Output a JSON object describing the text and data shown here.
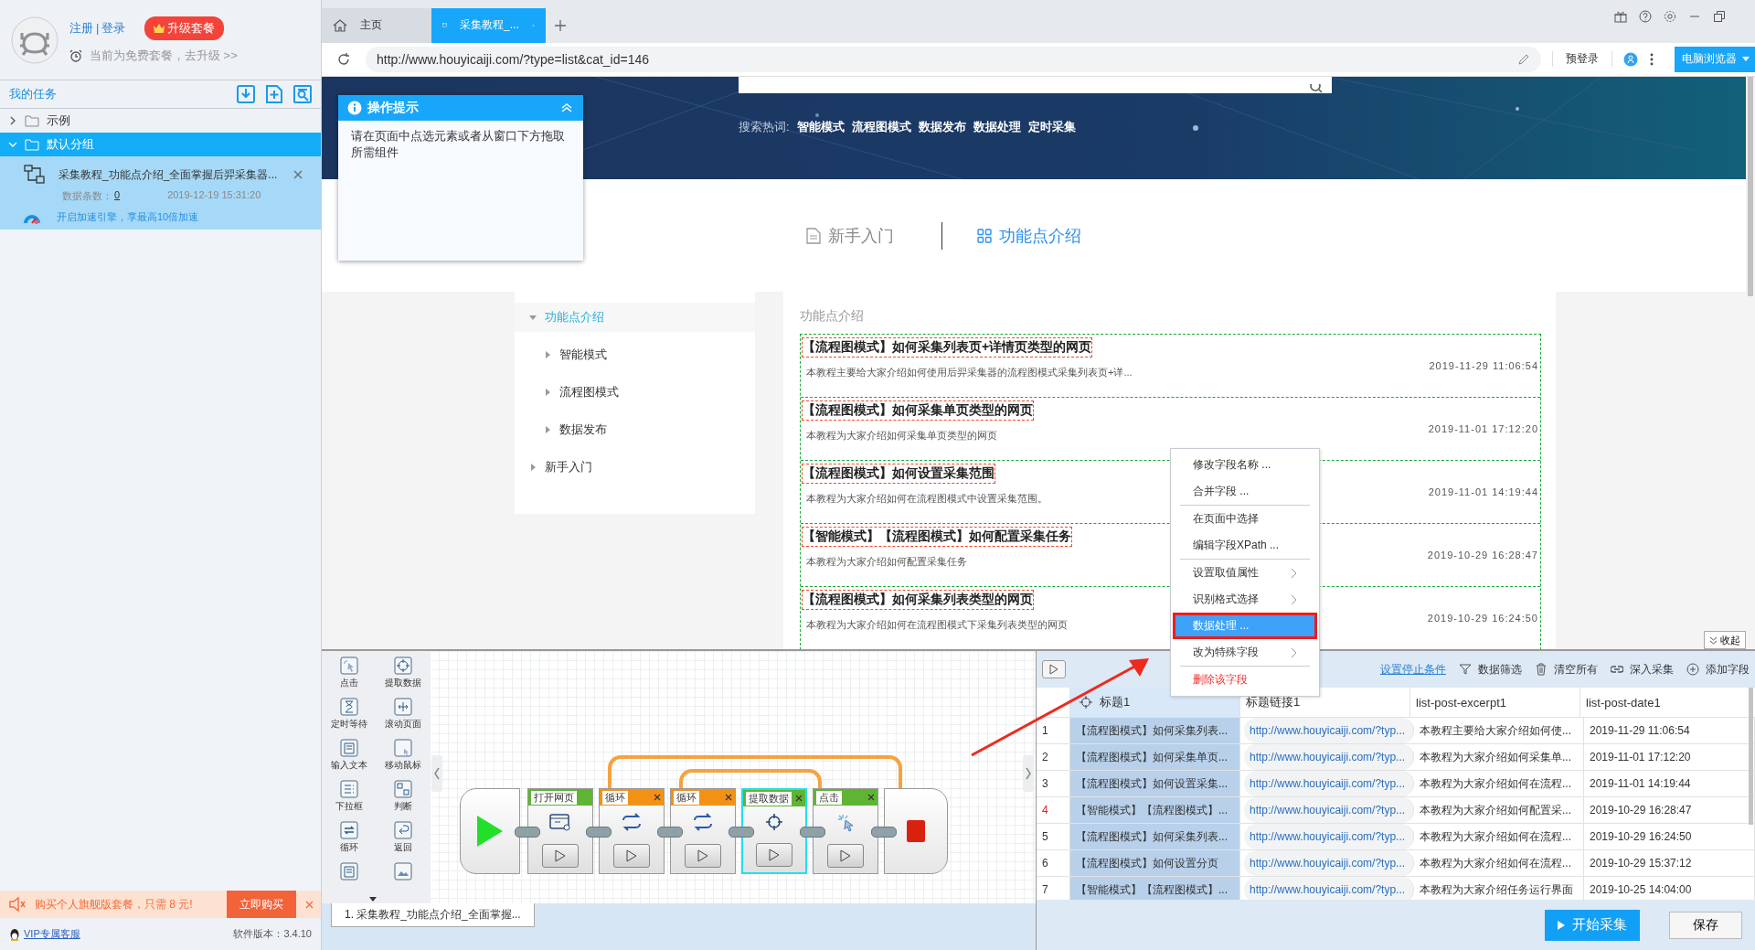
{
  "sidebar": {
    "register_link": "注册",
    "link_separator": "|",
    "login_link": "登录",
    "upgrade_button": "升级套餐",
    "plan_notice": "当前为免费套餐，去升级 >>",
    "tasks_title": "我的任务",
    "groups": [
      {
        "label": "示例",
        "expanded": false,
        "selected": false
      },
      {
        "label": "默认分组",
        "expanded": true,
        "selected": true,
        "children": [
          {
            "title": "采集教程_功能点介绍_全面掌握后羿采集器...",
            "count_label": "数据条数：",
            "count": "0",
            "date": "2019-12-19 15:31:20",
            "accelerate": "开启加速引擎，享最高10倍加速"
          }
        ]
      }
    ],
    "promo": {
      "text": "购买个人旗舰版套餐，只需 8 元!",
      "button": "立即购买"
    },
    "support_link": "VIP专属客服",
    "version": "软件版本：3.4.10"
  },
  "browser": {
    "tabs": [
      {
        "label": "主页",
        "kind": "home",
        "selected": false
      },
      {
        "label": "采集教程_...",
        "kind": "page",
        "selected": true
      }
    ],
    "url": "http://www.houyicaiji.com/?type=list&cat_id=146",
    "pre_login": "预登录",
    "mode_button": "电脑浏览器"
  },
  "page": {
    "hot_label": "搜索热词:",
    "hot_words": [
      "智能模式",
      "流程图模式",
      "数据发布",
      "数据处理",
      "定时采集"
    ],
    "section_tabs": [
      {
        "label": "新手入门",
        "kind": "doc",
        "selected": false
      },
      {
        "label": "功能点介绍",
        "kind": "grid",
        "selected": true
      }
    ],
    "nav": [
      {
        "label": "功能点介绍",
        "expanded": true,
        "selected": true,
        "children": [
          {
            "label": "智能模式"
          },
          {
            "label": "流程图模式"
          },
          {
            "label": "数据发布"
          }
        ]
      },
      {
        "label": "新手入门",
        "expanded": false,
        "selected": false
      }
    ],
    "list_title": "功能点介绍",
    "articles": [
      {
        "title": "【流程图模式】如何采集列表页+详情页类型的网页",
        "excerpt": "本教程主要给大家介绍如何使用后羿采集器的流程图模式采集列表页+详...",
        "date": "2019-11-29 11:06:54"
      },
      {
        "title": "【流程图模式】如何采集单页类型的网页",
        "excerpt": "本教程为大家介绍如何采集单页类型的网页",
        "date": "2019-11-01 17:12:20"
      },
      {
        "title": "【流程图模式】如何设置采集范围",
        "excerpt": "本教程为大家介绍如何在流程图模式中设置采集范围。",
        "date": "2019-11-01 14:19:44"
      },
      {
        "title": "【智能模式】【流程图模式】如何配置采集任务",
        "excerpt": "本教程为大家介绍如何配置采集任务",
        "date": "2019-10-29 16:28:47"
      },
      {
        "title": "【流程图模式】如何采集列表类型的网页",
        "excerpt": "本教程为大家介绍如何在流程图模式下采集列表类型的网页",
        "date": "2019-10-29 16:24:50"
      }
    ]
  },
  "tip_popup": {
    "title": "操作提示",
    "text": "请在页面中点选元素或者从窗口下方拖取所需组件"
  },
  "context_menu": [
    {
      "kind": "item",
      "label": "修改字段名称 ...",
      "submenu": false,
      "selected": false
    },
    {
      "kind": "item",
      "label": "合并字段 ...",
      "submenu": false,
      "selected": false
    },
    {
      "kind": "separator"
    },
    {
      "kind": "item",
      "label": "在页面中选择",
      "submenu": false,
      "selected": false
    },
    {
      "kind": "item",
      "label": "编辑字段XPath ...",
      "submenu": false,
      "selected": false
    },
    {
      "kind": "separator"
    },
    {
      "kind": "item",
      "label": "设置取值属性",
      "submenu": true,
      "selected": false
    },
    {
      "kind": "item",
      "label": "识别格式选择",
      "submenu": true,
      "selected": false
    },
    {
      "kind": "item",
      "label": "数据处理 ...",
      "submenu": false,
      "selected": true
    },
    {
      "kind": "item",
      "label": "改为特殊字段",
      "submenu": true,
      "selected": false
    },
    {
      "kind": "separator"
    },
    {
      "kind": "danger",
      "label": "删除该字段",
      "submenu": false,
      "selected": false
    }
  ],
  "collapse_button": "收起",
  "workflow": {
    "toolbox": [
      {
        "label": "点击",
        "kind": "click"
      },
      {
        "label": "提取数据",
        "kind": "extract"
      },
      {
        "label": "定时等待",
        "kind": "wait"
      },
      {
        "label": "滚动页面",
        "kind": "scroll"
      },
      {
        "label": "输入文本",
        "kind": "input"
      },
      {
        "label": "移动鼠标",
        "kind": "mouse"
      },
      {
        "label": "下拉框",
        "kind": "dropdown"
      },
      {
        "label": "判断",
        "kind": "branch"
      },
      {
        "label": "循环",
        "kind": "loop"
      },
      {
        "label": "返回",
        "kind": "back"
      },
      {
        "kind": "input"
      },
      {
        "kind": "image"
      }
    ],
    "nodes": [
      {
        "label": "打开网页",
        "kind": "open",
        "selected": false
      },
      {
        "label": "循环",
        "kind": "loop",
        "selected": false,
        "children": [
          {
            "label": "循环",
            "kind": "loop",
            "selected": false,
            "children": [
              {
                "label": "提取数据",
                "kind": "extract",
                "selected": true
              }
            ]
          },
          {
            "label": "点击",
            "kind": "click",
            "selected": false
          }
        ]
      }
    ],
    "task_tab": "1. 采集教程_功能点介绍_全面掌握..."
  },
  "data_table": {
    "stop_condition": "设置停止条件",
    "actions": [
      {
        "label": "数据筛选",
        "kind": "filter"
      },
      {
        "label": "清空所有",
        "kind": "clear"
      },
      {
        "label": "深入采集",
        "kind": "link"
      },
      {
        "label": "添加字段",
        "kind": "add"
      }
    ],
    "columns": [
      {
        "label": "标题1",
        "selected": true
      },
      {
        "label": "标题链接1",
        "selected": false
      },
      {
        "label": "list-post-excerpt1",
        "selected": false
      },
      {
        "label": "list-post-date1",
        "selected": false
      }
    ],
    "rows": [
      {
        "index": "1",
        "flagged": false,
        "cells": [
          "【流程图模式】如何采集列表...",
          "http://www.houyicaiji.com/?typ...",
          "本教程主要给大家介绍如何使...",
          "2019-11-29 11:06:54"
        ]
      },
      {
        "index": "2",
        "flagged": false,
        "cells": [
          "【流程图模式】如何采集单页...",
          "http://www.houyicaiji.com/?typ...",
          "本教程为大家介绍如何采集单...",
          "2019-11-01 17:12:20"
        ]
      },
      {
        "index": "3",
        "flagged": false,
        "cells": [
          "【流程图模式】如何设置采集...",
          "http://www.houyicaiji.com/?typ...",
          "本教程为大家介绍如何在流程...",
          "2019-11-01 14:19:44"
        ]
      },
      {
        "index": "4",
        "flagged": true,
        "cells": [
          "【智能模式】【流程图模式】...",
          "http://www.houyicaiji.com/?typ...",
          "本教程为大家介绍如何配置采...",
          "2019-10-29 16:28:47"
        ]
      },
      {
        "index": "5",
        "flagged": false,
        "cells": [
          "【流程图模式】如何采集列表...",
          "http://www.houyicaiji.com/?typ...",
          "本教程为大家介绍如何在流程...",
          "2019-10-29 16:24:50"
        ]
      },
      {
        "index": "6",
        "flagged": false,
        "cells": [
          "【流程图模式】如何设置分页",
          "http://www.houyicaiji.com/?typ...",
          "本教程为大家介绍如何在流程...",
          "2019-10-29 15:37:12"
        ]
      },
      {
        "index": "7",
        "flagged": false,
        "cells": [
          "【智能模式】【流程图模式】...",
          "http://www.houyicaiji.com/?typ...",
          "本教程为大家介绍任务运行界面",
          "2019-10-25 14:04:00"
        ]
      }
    ],
    "start_button": "开始采集",
    "save_button": "保存"
  }
}
